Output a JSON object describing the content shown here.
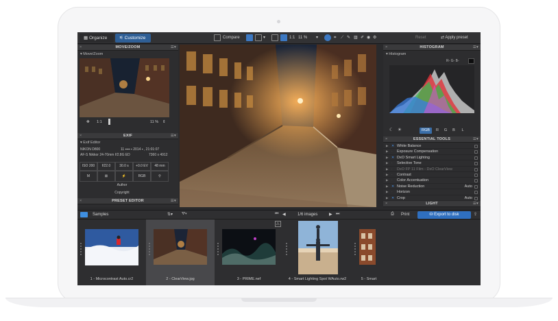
{
  "tabs": {
    "organize": "Organize",
    "customize": "Customize"
  },
  "toolbar": {
    "compare": "Compare",
    "zoom_label": "1:1",
    "zoom_value": "11 %",
    "reset": "Reset",
    "apply_preset": "Apply preset"
  },
  "left": {
    "move_zoom_title": "MOVE/ZOOM",
    "move_zoom_sub": "Move/Zoom",
    "zoom_ratio": "1:1",
    "zoom_percent": "11 %",
    "exif_title": "EXIF",
    "exif_sub": "Exif Editor",
    "camera": "NIKON D800",
    "date": "11 ▪▪▪▪ ▪ 2014 ▪ , 21:01:07",
    "lens": "AF-S Nikkor 24-70mm f/2.8G ED",
    "resolution": "7360 x 4912",
    "iso": "ISO 200",
    "aperture": "f/22.0",
    "shutter": "30.0 s",
    "ev": "+0.0 EV",
    "focal": "48 mm",
    "mode": "M",
    "colorspace": "RGB",
    "author": "Author",
    "copyright": "Copyright",
    "preset_editor_title": "PRESET EDITOR"
  },
  "right": {
    "histogram_title": "HISTOGRAM",
    "histogram_sub": "Histogram",
    "rgb_readout": "R-  G-  B-",
    "channels": [
      "RGB",
      "R",
      "G",
      "B",
      "L"
    ],
    "essential_title": "ESSENTIAL TOOLS",
    "tools": [
      {
        "label": "White Balance",
        "value": "",
        "checked": true
      },
      {
        "label": "Exposure Compensation",
        "value": "",
        "checked": false
      },
      {
        "label": "DxO Smart Lighting",
        "value": "",
        "checked": true
      },
      {
        "label": "Selective Tone",
        "value": "",
        "checked": false
      },
      {
        "label": "DxO FP 11 Film - DxO ClearView",
        "value": "",
        "checked": false
      },
      {
        "label": "Contrast",
        "value": "",
        "checked": false
      },
      {
        "label": "Color Accentuation",
        "value": "",
        "checked": false
      },
      {
        "label": "Noise Reduction",
        "value": "Auto",
        "checked": true
      },
      {
        "label": "Horizon",
        "value": "",
        "checked": false
      },
      {
        "label": "Crop",
        "value": "Auto",
        "checked": true
      }
    ],
    "light_title": "LIGHT"
  },
  "browser": {
    "folder": "Samples",
    "image_count": "1/6 images",
    "print": "Print",
    "export": "Export to disk"
  },
  "filmstrip": [
    {
      "label": "1 - Microcontrast Auto.cr2"
    },
    {
      "label": "2 - ClearView.jpg"
    },
    {
      "label": "3 - PRIME.nef"
    },
    {
      "label": "4 - Smart Lighting Spot WAuto.rw2"
    },
    {
      "label": "5 - Smart"
    }
  ],
  "colors": {
    "accent": "#2f6fbf",
    "panel": "#2d2d2f",
    "header": "#3a3a3c"
  }
}
